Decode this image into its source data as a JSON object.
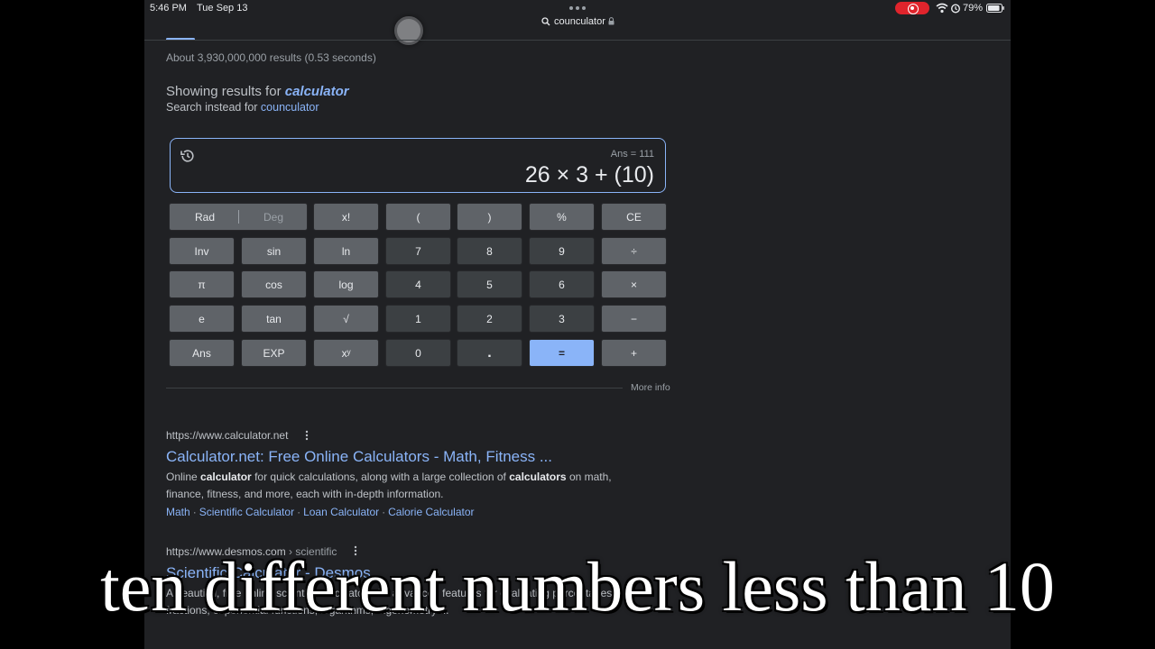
{
  "status_bar": {
    "time": "5:46 PM",
    "date": "Tue Sep 13",
    "battery": "79%"
  },
  "browser": {
    "url": "counculator"
  },
  "search": {
    "result_stats": "About 3,930,000,000 results (0.53 seconds)",
    "showing_prefix": "Showing results for ",
    "corrected_query": "calculator",
    "instead_prefix": "Search instead for ",
    "original_query": "counculator"
  },
  "calculator": {
    "ans_label": "Ans = 111",
    "expression": "26 × 3 + (10)",
    "rad_label": "Rad",
    "deg_label": "Deg",
    "keys": [
      [
        "",
        "x!",
        "(",
        ")",
        "%",
        "CE"
      ],
      [
        "Inv",
        "sin",
        "ln",
        "7",
        "8",
        "9",
        "÷"
      ],
      [
        "π",
        "cos",
        "log",
        "4",
        "5",
        "6",
        "×"
      ],
      [
        "e",
        "tan",
        "√",
        "1",
        "2",
        "3",
        "−"
      ],
      [
        "Ans",
        "EXP",
        "xʸ",
        "0",
        ".",
        "=",
        "+"
      ]
    ],
    "more_info": "More info"
  },
  "results": [
    {
      "url": "https://www.calculator.net",
      "crumb": "",
      "title": "Calculator.net: Free Online Calculators - Math, Fitness ...",
      "snippet_parts": [
        "Online ",
        "calculator",
        " for quick calculations, along with a large collection of ",
        "calculators",
        " on math,"
      ],
      "snippet_line2": "finance, fitness, and more, each with in-depth information.",
      "sitelinks": [
        "Math",
        "Scientific Calculator",
        "Loan Calculator",
        "Calorie Calculator"
      ]
    },
    {
      "url": "https://www.desmos.com",
      "crumb": " › scientific",
      "title": "Scientific Calculator - Desmos",
      "snippet_line1": "A beautiful, free online scientific calculator with advanced features for evaluating percentages,",
      "snippet_line2": "fractions, exponential functions, logarithms, trigonometry ..."
    }
  ],
  "caption": "ten different numbers less than 10",
  "colors": {
    "background": "#202124",
    "link": "#8ab4f8",
    "function_key": "#5f6368",
    "number_key": "#3c4043",
    "equals_key": "#8ab4f8",
    "record_pill": "#e0242c"
  }
}
